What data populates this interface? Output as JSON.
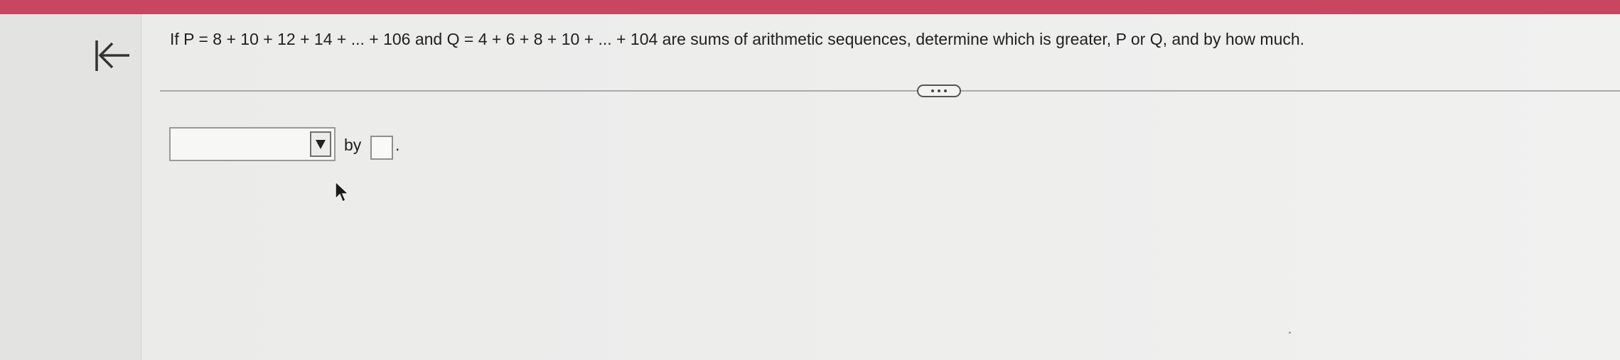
{
  "header": {
    "accent_color": "#c8465f"
  },
  "nav": {
    "back_icon": "arrow-left-to-bar-icon"
  },
  "question": {
    "text": "If P = 8 + 10 + 12 + 14 + ... + 106 and Q = 4 + 6 + 8 + 10 + ... + 104 are sums of arithmetic sequences, determine which is greater, P or Q, and by how much."
  },
  "toolbar": {
    "expand_icon": "more-horizontal-icon"
  },
  "answer": {
    "dropdown_selected": "",
    "by_label": "by",
    "input_value": "",
    "trailing_period": "."
  }
}
